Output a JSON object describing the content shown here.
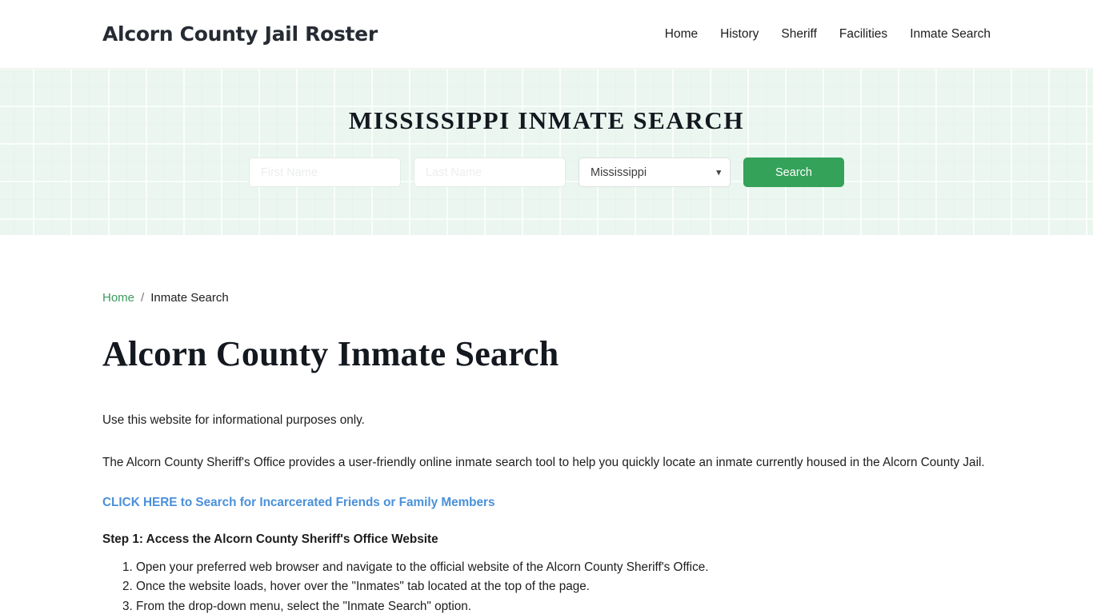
{
  "header": {
    "brand": "Alcorn County Jail Roster",
    "nav": [
      {
        "label": "Home"
      },
      {
        "label": "History"
      },
      {
        "label": "Sheriff"
      },
      {
        "label": "Facilities"
      },
      {
        "label": "Inmate Search"
      }
    ]
  },
  "hero": {
    "title": "MISSISSIPPI INMATE SEARCH",
    "first_name_placeholder": "First Name",
    "first_name_value": "",
    "last_name_placeholder": "Last Name",
    "last_name_value": "",
    "state_selected": "Mississippi",
    "state_options": [
      "Mississippi"
    ],
    "caret_icon": "chevron-down-icon",
    "search_label": "Search",
    "accent_color": "#34a259",
    "background_color": "#eaf6ef"
  },
  "breadcrumb": {
    "home": "Home",
    "separator": "/",
    "current": "Inmate Search",
    "link_color": "#3c9b5d"
  },
  "main": {
    "page_title": "Alcorn County Inmate Search",
    "paragraph_1": "Use this website for informational purposes only.",
    "paragraph_2": "The Alcorn County Sheriff's Office provides a user-friendly online inmate search tool to help you quickly locate an inmate currently housed in the Alcorn County Jail.",
    "cta_link": "CLICK HERE to Search for Incarcerated Friends or Family Members",
    "cta_color": "#4a90d9",
    "step_heading": "Step 1: Access the Alcorn County Sheriff's Office Website",
    "steps": [
      "Open your preferred web browser and navigate to the official website of the Alcorn County Sheriff's Office.",
      "Once the website loads, hover over the \"Inmates\" tab located at the top of the page.",
      "From the drop-down menu, select the \"Inmate Search\" option."
    ]
  }
}
